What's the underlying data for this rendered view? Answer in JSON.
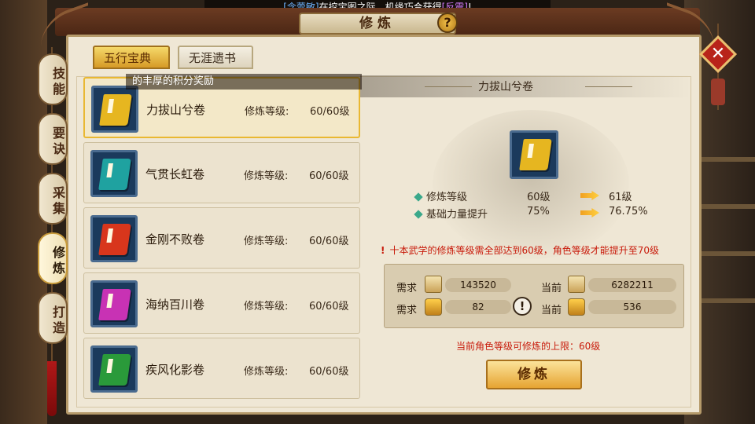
{
  "broadcast": {
    "player": "[含蕾敏]",
    "middle": "在挖宝图之际，机缘巧合获得",
    "item": "[反震]",
    "end": "!"
  },
  "window": {
    "title": "修炼",
    "help_label": "?",
    "close_label": "✕"
  },
  "tabs": [
    {
      "label": "五行宝典",
      "active": true
    },
    {
      "label": "无涯遗书",
      "active": false
    }
  ],
  "sidebar": {
    "items": [
      {
        "label": "技能"
      },
      {
        "label": "要诀"
      },
      {
        "label": "采集"
      },
      {
        "label": "修炼"
      },
      {
        "label": "打造"
      }
    ],
    "active_index": 3
  },
  "tooltip": "的丰厚的积分奖励",
  "list": [
    {
      "name": "力拔山兮卷",
      "level_label": "修炼等级:",
      "level_value": "60/60级",
      "color": "#e6b620"
    },
    {
      "name": "气贯长虹卷",
      "level_label": "修炼等级:",
      "level_value": "60/60级",
      "color": "#1fa2a0"
    },
    {
      "name": "金刚不败卷",
      "level_label": "修炼等级:",
      "level_value": "60/60级",
      "color": "#d8361c"
    },
    {
      "name": "海纳百川卷",
      "level_label": "修炼等级:",
      "level_value": "60/60级",
      "color": "#c832b4"
    },
    {
      "name": "疾风化影卷",
      "level_label": "修炼等级:",
      "level_value": "60/60级",
      "color": "#2a9a3a"
    }
  ],
  "detail": {
    "title": "力拔山兮卷",
    "book_color": "#e6b620",
    "stats": [
      {
        "label": "修炼等级",
        "current": "60级",
        "next": "61级"
      },
      {
        "label": "基础力量提升",
        "current": "75%",
        "next": "76.75%"
      }
    ],
    "warning_mark": "!",
    "warning": "十本武学的修炼等级需全部达到60级，角色等级才能提升至70级",
    "requirements": {
      "need_label": "需求",
      "have_label": "当前",
      "exp_icon_label": "经验",
      "exp_need": "143520",
      "exp_have": "6282211",
      "coin_need": "82",
      "coin_have": "536",
      "alert": "!"
    },
    "limit_text": "当前角色等级可修炼的上限：60级",
    "train_button": "修炼"
  }
}
